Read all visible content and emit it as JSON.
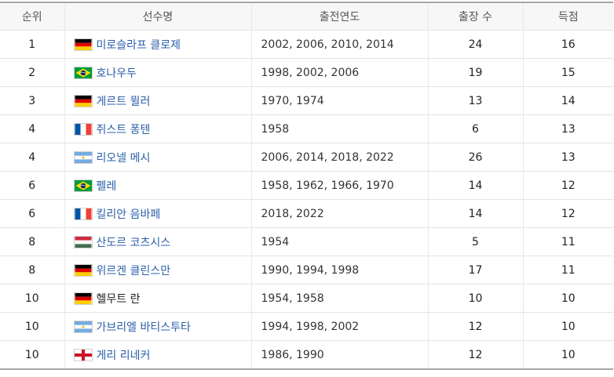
{
  "headers": {
    "rank": "순위",
    "player": "선수명",
    "years": "출전연도",
    "apps": "출장 수",
    "goals": "득점"
  },
  "rows": [
    {
      "rank": "1",
      "flag": "germany-flag",
      "name": "미로슬라프 클로제",
      "linked": true,
      "years": "2002, 2006, 2010, 2014",
      "apps": "24",
      "goals": "16"
    },
    {
      "rank": "2",
      "flag": "brazil-flag",
      "name": "호나우두",
      "linked": true,
      "years": "1998, 2002, 2006",
      "apps": "19",
      "goals": "15"
    },
    {
      "rank": "3",
      "flag": "germany-flag",
      "name": "게르트 뮐러",
      "linked": true,
      "years": "1970, 1974",
      "apps": "13",
      "goals": "14"
    },
    {
      "rank": "4",
      "flag": "france-flag",
      "name": "쥐스트 퐁텐",
      "linked": true,
      "years": "1958",
      "apps": "6",
      "goals": "13"
    },
    {
      "rank": "4",
      "flag": "argentina-flag",
      "name": "리오넬 메시",
      "linked": true,
      "years": "2006, 2014, 2018, 2022",
      "apps": "26",
      "goals": "13"
    },
    {
      "rank": "6",
      "flag": "brazil-flag",
      "name": "펠레",
      "linked": true,
      "years": "1958, 1962, 1966, 1970",
      "apps": "14",
      "goals": "12"
    },
    {
      "rank": "6",
      "flag": "france-flag",
      "name": "킬리안 음바페",
      "linked": true,
      "years": "2018, 2022",
      "apps": "14",
      "goals": "12"
    },
    {
      "rank": "8",
      "flag": "hungary-flag",
      "name": "산도르 코츠시스",
      "linked": true,
      "years": "1954",
      "apps": "5",
      "goals": "11"
    },
    {
      "rank": "8",
      "flag": "germany-flag",
      "name": "위르겐 클린스만",
      "linked": true,
      "years": "1990, 1994, 1998",
      "apps": "17",
      "goals": "11"
    },
    {
      "rank": "10",
      "flag": "germany-flag",
      "name": "헬무트 란",
      "linked": false,
      "years": "1954, 1958",
      "apps": "10",
      "goals": "10"
    },
    {
      "rank": "10",
      "flag": "argentina-flag",
      "name": "가브리엘 바티스투타",
      "linked": true,
      "years": "1994, 1998, 2002",
      "apps": "12",
      "goals": "10"
    },
    {
      "rank": "10",
      "flag": "england-flag",
      "name": "게리 리네커",
      "linked": true,
      "years": "1986, 1990",
      "apps": "12",
      "goals": "10"
    }
  ]
}
